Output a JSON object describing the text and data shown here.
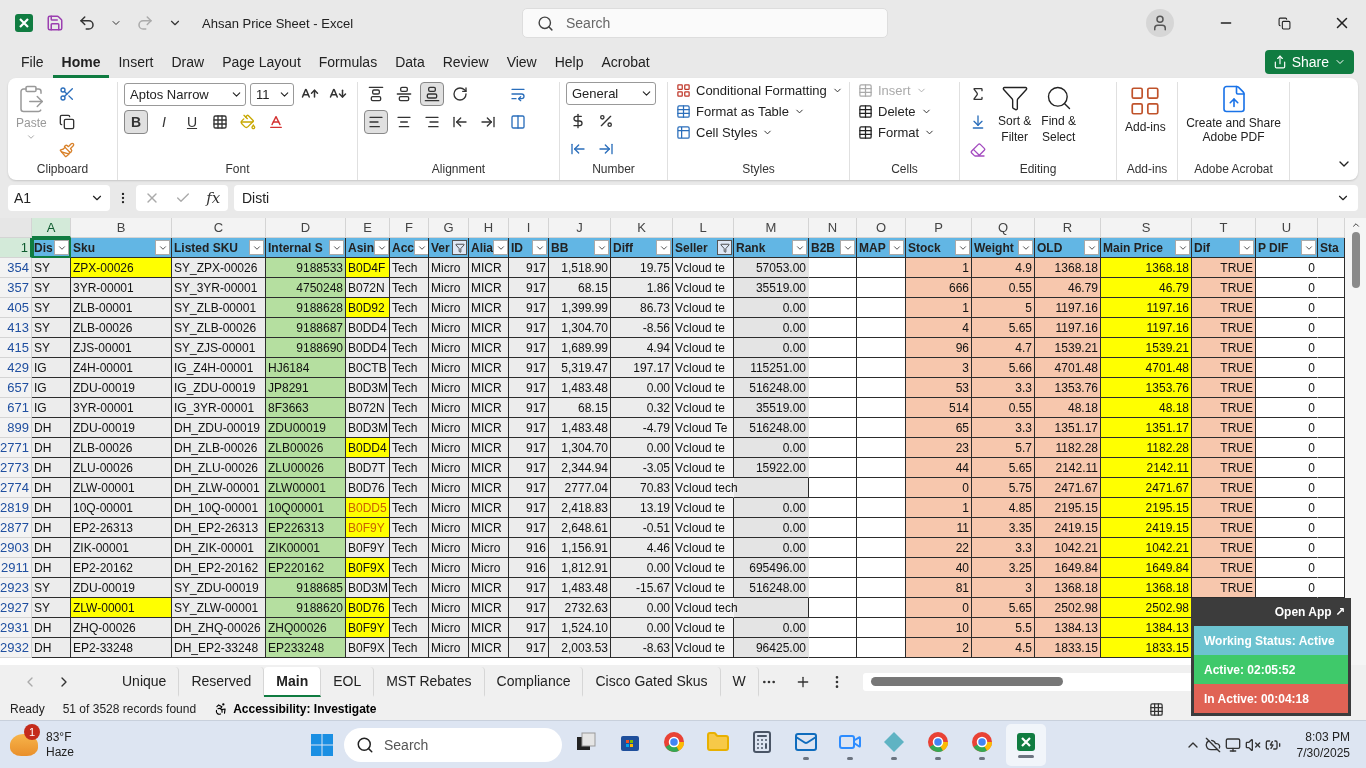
{
  "window": {
    "title": "Ahsan Price Sheet  -  Excel",
    "search_placeholder": "Search"
  },
  "menu_tabs": [
    {
      "label": "File",
      "selected": false
    },
    {
      "label": "Home",
      "selected": true
    },
    {
      "label": "Insert",
      "selected": false
    },
    {
      "label": "Draw",
      "selected": false
    },
    {
      "label": "Page Layout",
      "selected": false
    },
    {
      "label": "Formulas",
      "selected": false
    },
    {
      "label": "Data",
      "selected": false
    },
    {
      "label": "Review",
      "selected": false
    },
    {
      "label": "View",
      "selected": false
    },
    {
      "label": "Help",
      "selected": false
    },
    {
      "label": "Acrobat",
      "selected": false
    }
  ],
  "share": {
    "label": "Share"
  },
  "clipboard": {
    "label": "Clipboard",
    "paste": {
      "label": "Paste",
      "disabled": true
    }
  },
  "font": {
    "label": "Font",
    "font_name": "Aptos Narrow",
    "font_size": "11",
    "styles": [
      {
        "label": "B",
        "pressed": true
      },
      {
        "label": "I",
        "pressed": false
      },
      {
        "label": "U",
        "pressed": false
      }
    ]
  },
  "alignment": {
    "label": "Alignment",
    "top_row": [
      {
        "kind": "top",
        "pressed": false
      },
      {
        "kind": "middle",
        "pressed": false
      },
      {
        "kind": "bottom",
        "pressed": true
      },
      {
        "kind": "orientation",
        "pressed": false
      }
    ],
    "bottom_row": [
      {
        "kind": "left",
        "pressed": true
      },
      {
        "kind": "center",
        "pressed": false
      },
      {
        "kind": "right",
        "pressed": false
      },
      {
        "kind": "outdent",
        "pressed": false
      },
      {
        "kind": "indent",
        "pressed": false
      }
    ]
  },
  "number": {
    "label": "Number",
    "format": "General"
  },
  "styles": {
    "label": "Styles",
    "items": [
      "Conditional Formatting",
      "Format as Table",
      "Cell Styles"
    ]
  },
  "cells": {
    "label": "Cells",
    "items": [
      {
        "label": "Insert",
        "disabled": true
      },
      {
        "label": "Delete",
        "disabled": false
      },
      {
        "label": "Format",
        "disabled": false
      }
    ]
  },
  "editing": {
    "label": "Editing",
    "sort": [
      "Sort &",
      "Filter"
    ],
    "find": [
      "Find &",
      "Select"
    ]
  },
  "addins": {
    "label": "Add-ins",
    "button": "Add-ins"
  },
  "acrobat": {
    "label": "Adobe Acrobat",
    "button": "Create and Share Adobe PDF"
  },
  "formula_bar": {
    "name_box": "A1",
    "function_label": "fx",
    "formula": "Disti"
  },
  "table": {
    "corner_row": "1",
    "columns": [
      {
        "letter": "A",
        "header": "Dis",
        "color": "#ececec",
        "filtered": false,
        "selected": true
      },
      {
        "letter": "B",
        "header": "Sku",
        "color": "#ececec",
        "filtered": false,
        "selected": false
      },
      {
        "letter": "C",
        "header": "Listed SKU",
        "color": "#ececec",
        "filtered": false,
        "selected": false
      },
      {
        "letter": "D",
        "header": "Internal S",
        "color": "#b5dfa0",
        "filtered": false,
        "selected": false
      },
      {
        "letter": "E",
        "header": "Asin",
        "color": "#ececec",
        "filtered": false,
        "selected": false
      },
      {
        "letter": "F",
        "header": "Acc",
        "color": "#ececec",
        "filtered": false,
        "selected": false
      },
      {
        "letter": "G",
        "header": "Ver",
        "color": "#ececec",
        "filtered": true,
        "selected": false
      },
      {
        "letter": "H",
        "header": "Alia",
        "color": "#ececec",
        "filtered": false,
        "selected": false
      },
      {
        "letter": "I",
        "header": "ID",
        "color": "#ececec",
        "filtered": false,
        "selected": false
      },
      {
        "letter": "J",
        "header": "BB",
        "color": "#ececec",
        "filtered": false,
        "selected": false
      },
      {
        "letter": "K",
        "header": "Diff",
        "color": "#ececec",
        "filtered": false,
        "selected": false
      },
      {
        "letter": "L",
        "header": "Seller",
        "color": "#f4f4f4",
        "filtered": true,
        "selected": false
      },
      {
        "letter": "M",
        "header": "Rank",
        "color": "#e4e4e4",
        "filtered": false,
        "selected": false
      },
      {
        "letter": "N",
        "header": "B2B",
        "color": "#ffffff",
        "filtered": false,
        "selected": false
      },
      {
        "letter": "O",
        "header": "MAP",
        "color": "#ffffff",
        "filtered": false,
        "selected": false
      },
      {
        "letter": "P",
        "header": "Stock",
        "color": "#f7c7ad",
        "filtered": false,
        "selected": false
      },
      {
        "letter": "Q",
        "header": "Weight",
        "color": "#f7c7ad",
        "filtered": false,
        "selected": false
      },
      {
        "letter": "R",
        "header": "OLD",
        "color": "#f7c7ad",
        "filtered": false,
        "selected": false
      },
      {
        "letter": "S",
        "header": "Main Price",
        "color": "#ffff00",
        "filtered": false,
        "selected": false
      },
      {
        "letter": "T",
        "header": "Dif",
        "color": "#f7c7ad",
        "filtered": false,
        "selected": false
      },
      {
        "letter": "U",
        "header": "P DIF",
        "color": "#ffffff",
        "filtered": false,
        "selected": false
      },
      {
        "header": "Sta",
        "color": "#ffffff",
        "selected": false
      }
    ],
    "rows": [
      {
        "number": "354",
        "sku_highlight": true,
        "asin_highlight": true,
        "asin_warning": false,
        "cells": [
          "SY",
          "ZPX-00026",
          "SY_ZPX-00026",
          "9188533",
          "B0D4F",
          "Tech",
          "Micro",
          "MICR",
          "917",
          "1,518.90",
          "19.75",
          "Vcloud te",
          "57053.00",
          null,
          null,
          "1",
          "4.9",
          "1368.18",
          "1368.18",
          "TRUE",
          "0",
          null
        ]
      },
      {
        "number": "357",
        "sku_highlight": false,
        "asin_highlight": false,
        "asin_warning": false,
        "cells": [
          "SY",
          "3YR-00001",
          "SY_3YR-00001",
          "4750248",
          "B072N",
          "Tech",
          "Micro",
          "MICR",
          "917",
          "68.15",
          "1.86",
          "Vcloud te",
          "35519.00",
          null,
          null,
          "666",
          "0.55",
          "46.79",
          "46.79",
          "TRUE",
          "0",
          null
        ]
      },
      {
        "number": "405",
        "sku_highlight": false,
        "asin_highlight": true,
        "asin_warning": false,
        "cells": [
          "SY",
          "ZLB-00001",
          "SY_ZLB-00001",
          "9188628",
          "B0D92",
          "Tech",
          "Micro",
          "MICR",
          "917",
          "1,399.99",
          "86.73",
          "Vcloud te",
          "0.00",
          null,
          null,
          "1",
          "5",
          "1197.16",
          "1197.16",
          "TRUE",
          "0",
          null
        ]
      },
      {
        "number": "413",
        "sku_highlight": false,
        "asin_highlight": false,
        "asin_warning": false,
        "cells": [
          "SY",
          "ZLB-00026",
          "SY_ZLB-00026",
          "9188687",
          "B0DD4",
          "Tech",
          "Micro",
          "MICR",
          "917",
          "1,304.70",
          "-8.56",
          "Vcloud te",
          "0.00",
          null,
          null,
          "4",
          "5.65",
          "1197.16",
          "1197.16",
          "TRUE",
          "0",
          null
        ]
      },
      {
        "number": "415",
        "sku_highlight": false,
        "asin_highlight": false,
        "asin_warning": false,
        "cells": [
          "SY",
          "ZJS-00001",
          "SY_ZJS-00001",
          "9188690",
          "B0DD4",
          "Tech",
          "Micro",
          "MICR",
          "917",
          "1,689.99",
          "4.94",
          "Vcloud te",
          "0.00",
          null,
          null,
          "96",
          "4.7",
          "1539.21",
          "1539.21",
          "TRUE",
          "0",
          null
        ]
      },
      {
        "number": "429",
        "sku_highlight": false,
        "asin_highlight": false,
        "asin_warning": false,
        "cells": [
          "IG",
          "Z4H-00001",
          "IG_Z4H-00001",
          "HJ6184",
          "B0CTB",
          "Tech",
          "Micro",
          "MICR",
          "917",
          "5,319.47",
          "197.17",
          "Vcloud te",
          "115251.00",
          null,
          null,
          "3",
          "5.66",
          "4701.48",
          "4701.48",
          "TRUE",
          "0",
          null
        ]
      },
      {
        "number": "657",
        "sku_highlight": false,
        "asin_highlight": false,
        "asin_warning": false,
        "cells": [
          "IG",
          "ZDU-00019",
          "IG_ZDU-00019",
          "JP8291",
          "B0D3M",
          "Tech",
          "Micro",
          "MICR",
          "917",
          "1,483.48",
          "0.00",
          "Vcloud te",
          "516248.00",
          null,
          null,
          "53",
          "3.3",
          "1353.76",
          "1353.76",
          "TRUE",
          "0",
          null
        ]
      },
      {
        "number": "671",
        "sku_highlight": false,
        "asin_highlight": false,
        "asin_warning": false,
        "cells": [
          "IG",
          "3YR-00001",
          "IG_3YR-00001",
          "8F3663",
          "B072N",
          "Tech",
          "Micro",
          "MICR",
          "917",
          "68.15",
          "0.32",
          "Vcloud te",
          "35519.00",
          null,
          null,
          "514",
          "0.55",
          "48.18",
          "48.18",
          "TRUE",
          "0",
          null
        ]
      },
      {
        "number": "899",
        "sku_highlight": false,
        "asin_highlight": false,
        "asin_warning": false,
        "cells": [
          "DH",
          "ZDU-00019",
          "DH_ZDU-00019",
          "ZDU00019",
          "B0D3M",
          "Tech",
          "Micro",
          "MICR",
          "917",
          "1,483.48",
          "-4.79",
          "Vcloud Te",
          "516248.00",
          null,
          null,
          "65",
          "3.3",
          "1351.17",
          "1351.17",
          "TRUE",
          "0",
          null
        ]
      },
      {
        "number": "2771",
        "sku_highlight": false,
        "asin_highlight": true,
        "asin_warning": false,
        "cells": [
          "DH",
          "ZLB-00026",
          "DH_ZLB-00026",
          "ZLB00026",
          "B0DD4",
          "Tech",
          "Micro",
          "MICR",
          "917",
          "1,304.70",
          "0.00",
          "Vcloud te",
          "0.00",
          null,
          null,
          "23",
          "5.7",
          "1182.28",
          "1182.28",
          "TRUE",
          "0",
          null
        ]
      },
      {
        "number": "2773",
        "sku_highlight": false,
        "asin_highlight": false,
        "asin_warning": false,
        "cells": [
          "DH",
          "ZLU-00026",
          "DH_ZLU-00026",
          "ZLU00026",
          "B0D7T",
          "Tech",
          "Micro",
          "MICR",
          "917",
          "2,344.94",
          "-3.05",
          "Vcloud te",
          "15922.00",
          null,
          null,
          "44",
          "5.65",
          "2142.11",
          "2142.11",
          "TRUE",
          "0",
          null
        ]
      },
      {
        "number": "2774",
        "sku_highlight": false,
        "asin_highlight": false,
        "asin_warning": false,
        "cells": [
          "DH",
          "ZLW-00001",
          "DH_ZLW-00001",
          "ZLW00001",
          "B0D76",
          "Tech",
          "Micro",
          "MICR",
          "917",
          "2777.04",
          "70.83",
          "Vcloud tech",
          null,
          null,
          null,
          "0",
          "5.75",
          "2471.67",
          "2471.67",
          "TRUE",
          "0",
          null
        ]
      },
      {
        "number": "2819",
        "sku_highlight": false,
        "asin_highlight": true,
        "asin_warning": true,
        "cells": [
          "DH",
          "10Q-00001",
          "DH_10Q-00001",
          "10Q00001",
          "B0DD5",
          "Tech",
          "Micro",
          "MICR",
          "917",
          "2,418.83",
          "13.19",
          "Vcloud te",
          "0.00",
          null,
          null,
          "1",
          "4.85",
          "2195.15",
          "2195.15",
          "TRUE",
          "0",
          null
        ]
      },
      {
        "number": "2877",
        "sku_highlight": false,
        "asin_highlight": true,
        "asin_warning": true,
        "cells": [
          "DH",
          "EP2-26313",
          "DH_EP2-26313",
          "EP226313",
          "B0F9Y",
          "Tech",
          "Micro",
          "MICR",
          "917",
          "2,648.61",
          "-0.51",
          "Vcloud te",
          "0.00",
          null,
          null,
          "11",
          "3.35",
          "2419.15",
          "2419.15",
          "TRUE",
          "0",
          null
        ]
      },
      {
        "number": "2903",
        "sku_highlight": false,
        "asin_highlight": false,
        "asin_warning": false,
        "cells": [
          "DH",
          "ZIK-00001",
          "DH_ZIK-00001",
          "ZIK00001",
          "B0F9Y",
          "Tech",
          "Micro",
          "Micro",
          "916",
          "1,156.91",
          "4.46",
          "Vcloud te",
          "0.00",
          null,
          null,
          "22",
          "3.3",
          "1042.21",
          "1042.21",
          "TRUE",
          "0",
          null
        ]
      },
      {
        "number": "2911",
        "sku_highlight": false,
        "asin_highlight": true,
        "asin_warning": false,
        "cells": [
          "DH",
          "EP2-20162",
          "DH_EP2-20162",
          "EP220162",
          "B0F9X",
          "Tech",
          "Micro",
          "Micro",
          "916",
          "1,812.91",
          "0.00",
          "Vcloud te",
          "695496.00",
          null,
          null,
          "40",
          "3.25",
          "1649.84",
          "1649.84",
          "TRUE",
          "0",
          null
        ]
      },
      {
        "number": "2923",
        "sku_highlight": false,
        "asin_highlight": false,
        "asin_warning": false,
        "cells": [
          "SY",
          "ZDU-00019",
          "SY_ZDU-00019",
          "9188685",
          "B0D3M",
          "Tech",
          "Micro",
          "MICR",
          "917",
          "1,483.48",
          "-15.67",
          "Vcloud te",
          "516248.00",
          null,
          null,
          "81",
          "3",
          "1368.18",
          "1368.18",
          "TRUE",
          "0",
          null
        ]
      },
      {
        "number": "2927",
        "sku_highlight": true,
        "asin_highlight": true,
        "asin_warning": false,
        "cells": [
          "SY",
          "ZLW-00001",
          "SY_ZLW-00001",
          "9188620",
          "B0D76",
          "Tech",
          "Micro",
          "MICR",
          "917",
          "2732.63",
          "0.00",
          "Vcloud tech",
          null,
          null,
          null,
          "0",
          "5.65",
          "2502.98",
          "2502.98"
        ]
      },
      {
        "number": "2931",
        "sku_highlight": false,
        "asin_highlight": true,
        "asin_warning": false,
        "cells": [
          "DH",
          "ZHQ-00026",
          "DH_ZHQ-00026",
          "ZHQ00026",
          "B0F9Y",
          "Tech",
          "Micro",
          "MICR",
          "917",
          "1,524.10",
          "0.00",
          "Vcloud te",
          "0.00",
          null,
          null,
          "10",
          "5.5",
          "1384.13",
          "1384.13"
        ]
      },
      {
        "number": "2932",
        "sku_highlight": false,
        "asin_highlight": false,
        "asin_warning": false,
        "cells": [
          "DH",
          "EP2-33248",
          "DH_EP2-33248",
          "EP233248",
          "B0F9X",
          "Tech",
          "Micro",
          "MICR",
          "917",
          "2,003.53",
          "-8.63",
          "Vcloud te",
          "96425.00",
          null,
          null,
          "2",
          "4.5",
          "1833.15",
          "1833.15"
        ]
      }
    ]
  },
  "sheet_tabs": [
    {
      "label": "Unique",
      "selected": false
    },
    {
      "label": "Reserved",
      "selected": false
    },
    {
      "label": "Main",
      "selected": true
    },
    {
      "label": "EOL",
      "selected": false
    },
    {
      "label": "MST Rebates",
      "selected": false
    },
    {
      "label": "Compliance",
      "selected": false
    },
    {
      "label": "Cisco Gated Skus",
      "selected": false
    },
    {
      "label": "W",
      "selected": false
    }
  ],
  "status_bar": {
    "mode": "Ready",
    "records": "51 of 3528 records found",
    "accessibility": "Accessibility: Investigate"
  },
  "tracker": {
    "open_app": "Open App ↗",
    "status": "Working Status: Active",
    "active": "Active: 02:05:52",
    "inactive": "In Active: 00:04:18"
  },
  "taskbar": {
    "temperature": "83°F",
    "condition": "Haze",
    "weather_badge": "1",
    "search_placeholder": "Search",
    "time": "8:03 PM",
    "date": "7/30/2025",
    "apps": [
      {
        "kind": "task-view",
        "running": false,
        "active": false
      },
      {
        "kind": "store",
        "running": false,
        "active": false
      },
      {
        "kind": "browser",
        "running": false,
        "active": false
      },
      {
        "kind": "folder",
        "running": false,
        "active": false
      },
      {
        "kind": "calculator",
        "running": false,
        "active": false
      },
      {
        "kind": "mail",
        "running": true,
        "active": false
      },
      {
        "kind": "video",
        "running": true,
        "active": false
      },
      {
        "kind": "diamond",
        "running": true,
        "active": false
      },
      {
        "kind": "browser",
        "running": true,
        "active": false
      },
      {
        "kind": "browser",
        "running": true,
        "active": false
      },
      {
        "kind": "spreadsheet",
        "running": true,
        "active": true
      }
    ]
  }
}
